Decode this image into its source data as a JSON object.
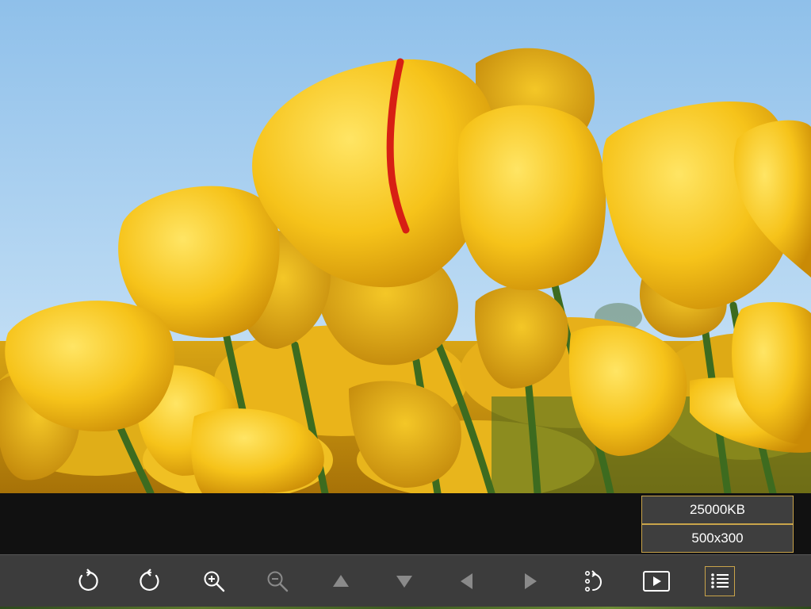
{
  "info": {
    "file_size": "25000KB",
    "dimensions": "500x300"
  },
  "toolbar": {
    "buttons": [
      {
        "icon": "rotate-left-icon",
        "enabled": true
      },
      {
        "icon": "rotate-right-icon",
        "enabled": true
      },
      {
        "icon": "zoom-in-icon",
        "enabled": true
      },
      {
        "icon": "zoom-out-icon",
        "enabled": false
      },
      {
        "icon": "arrow-up-icon",
        "enabled": false
      },
      {
        "icon": "arrow-down-icon",
        "enabled": false
      },
      {
        "icon": "arrow-left-icon",
        "enabled": false
      },
      {
        "icon": "arrow-right-icon",
        "enabled": false
      },
      {
        "icon": "rotate-dots-icon",
        "enabled": true
      },
      {
        "icon": "slideshow-play-icon",
        "enabled": true
      },
      {
        "icon": "list-menu-icon",
        "enabled": true,
        "active": true
      }
    ]
  },
  "colors": {
    "accent": "#c9a44a",
    "toolbar_bg": "#3c3c3c",
    "icon_enabled": "#ffffff",
    "icon_disabled": "#8a8a8a"
  }
}
